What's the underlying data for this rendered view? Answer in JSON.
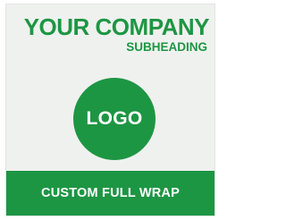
{
  "header": {
    "company_name": "YOUR COMPANY",
    "subheading": "SUBHEADING"
  },
  "logo": {
    "label": "LOGO"
  },
  "banner": {
    "label": "CUSTOM FULL WRAP"
  },
  "colors": {
    "brand_green": "#1d9643",
    "background": "#eff1ef",
    "text_on_green": "#ffffff"
  }
}
